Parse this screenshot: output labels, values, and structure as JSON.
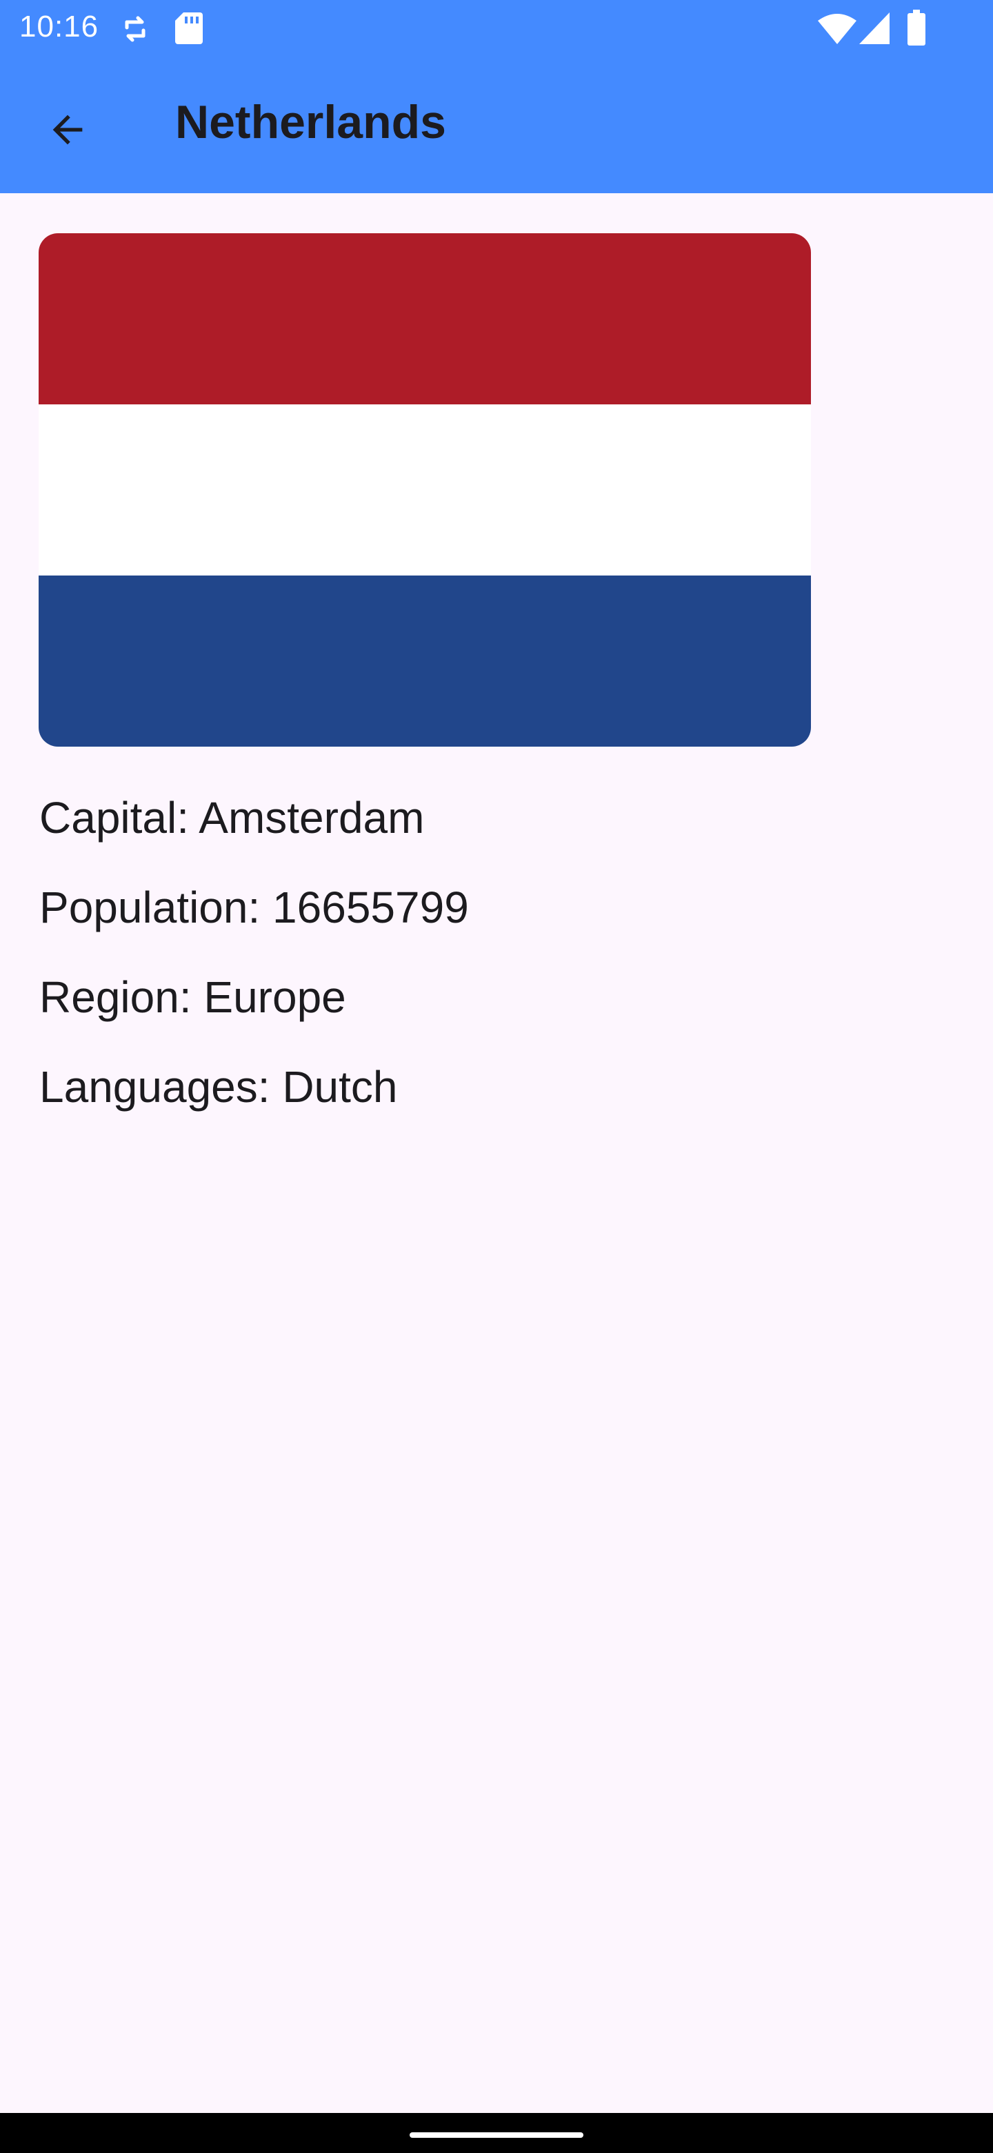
{
  "status_bar": {
    "time": "10:16",
    "icons": [
      "sync-icon",
      "sd-card-icon",
      "wifi-icon",
      "cell-signal-icon",
      "battery-icon"
    ]
  },
  "appbar": {
    "title": "Netherlands",
    "back_icon": "arrow-back-icon",
    "background_color": "#448aff"
  },
  "flag": {
    "stripes": [
      {
        "name": "red",
        "color": "#ae1c28"
      },
      {
        "name": "white",
        "color": "#ffffff"
      },
      {
        "name": "blue",
        "color": "#21468b"
      }
    ]
  },
  "details": {
    "capital": "Capital: Amsterdam",
    "population": "Population: 16655799",
    "region": "Region: Europe",
    "languages": "Languages: Dutch"
  }
}
